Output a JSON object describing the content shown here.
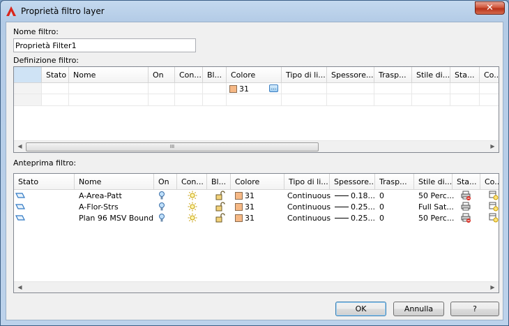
{
  "window": {
    "title": "Proprietà filtro layer",
    "close_glyph": "✕"
  },
  "filter_name": {
    "label": "Nome filtro:",
    "value": "Proprietà Filter1"
  },
  "definition": {
    "label": "Definizione filtro:",
    "columns": [
      "",
      "Stato",
      "Nome",
      "On",
      "Con...",
      "Bl...",
      "Colore",
      "Tipo di li...",
      "Spessore...",
      "Trasp...",
      "Stile di...",
      "Sta...",
      "Co..."
    ],
    "row": {
      "colore": "31"
    },
    "color_button_glyph": "…",
    "scroll_left": "◀",
    "scroll_right": "▶",
    "thumb_grip": "III"
  },
  "preview": {
    "label": "Anteprima filtro:",
    "columns": [
      "Stato",
      "Nome",
      "On",
      "Con...",
      "Bl...",
      "Colore",
      "Tipo di li...",
      "Spessore...",
      "Trasp...",
      "Stile di...",
      "Sta...",
      "Co..."
    ],
    "rows": [
      {
        "nome": "A-Area-Patt",
        "colore": "31",
        "tipo": "Continuous",
        "spessore": "0.18...",
        "trasp": "0",
        "stile": "50 Perc...",
        "stato_plot": "no-plot"
      },
      {
        "nome": "A-Flor-Strs",
        "colore": "31",
        "tipo": "Continuous",
        "spessore": "0.25...",
        "trasp": "0",
        "stile": "Full Sat...",
        "stato_plot": "plot"
      },
      {
        "nome": "Plan 96 MSV Bound...",
        "colore": "31",
        "tipo": "Continuous",
        "spessore": "0.25...",
        "trasp": "0",
        "stile": "50 Perc...",
        "stato_plot": "no-plot"
      }
    ],
    "scroll_left": "◀",
    "scroll_right": "▶"
  },
  "buttons": {
    "ok": "OK",
    "cancel": "Annulla",
    "help": "?"
  },
  "colors": {
    "swatch": "#f6b885",
    "accent": "#3c7fb1"
  }
}
